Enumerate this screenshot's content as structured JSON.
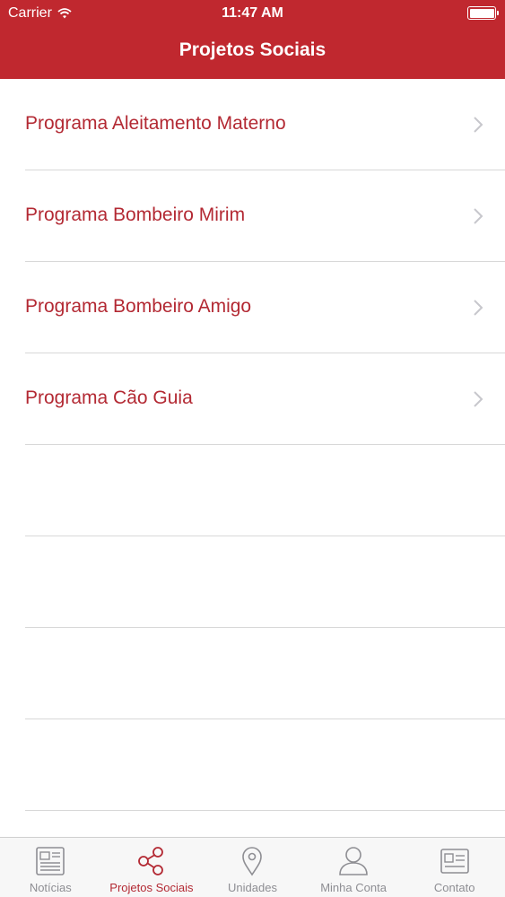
{
  "status_bar": {
    "carrier": "Carrier",
    "time": "11:47 AM"
  },
  "header": {
    "title": "Projetos Sociais"
  },
  "list": {
    "items": [
      {
        "label": "Programa Aleitamento Materno"
      },
      {
        "label": "Programa Bombeiro Mirim"
      },
      {
        "label": "Programa Bombeiro Amigo"
      },
      {
        "label": "Programa Cão Guia"
      }
    ]
  },
  "tabbar": {
    "tabs": [
      {
        "label": "Notícias",
        "icon": "newspaper-icon"
      },
      {
        "label": "Projetos Sociais",
        "icon": "share-icon",
        "active": true
      },
      {
        "label": "Unidades",
        "icon": "location-pin-icon"
      },
      {
        "label": "Minha Conta",
        "icon": "person-icon"
      },
      {
        "label": "Contato",
        "icon": "contact-card-icon"
      }
    ]
  },
  "colors": {
    "header": "#c0282f",
    "accent": "#b32933",
    "inactive": "#8e8e93"
  }
}
